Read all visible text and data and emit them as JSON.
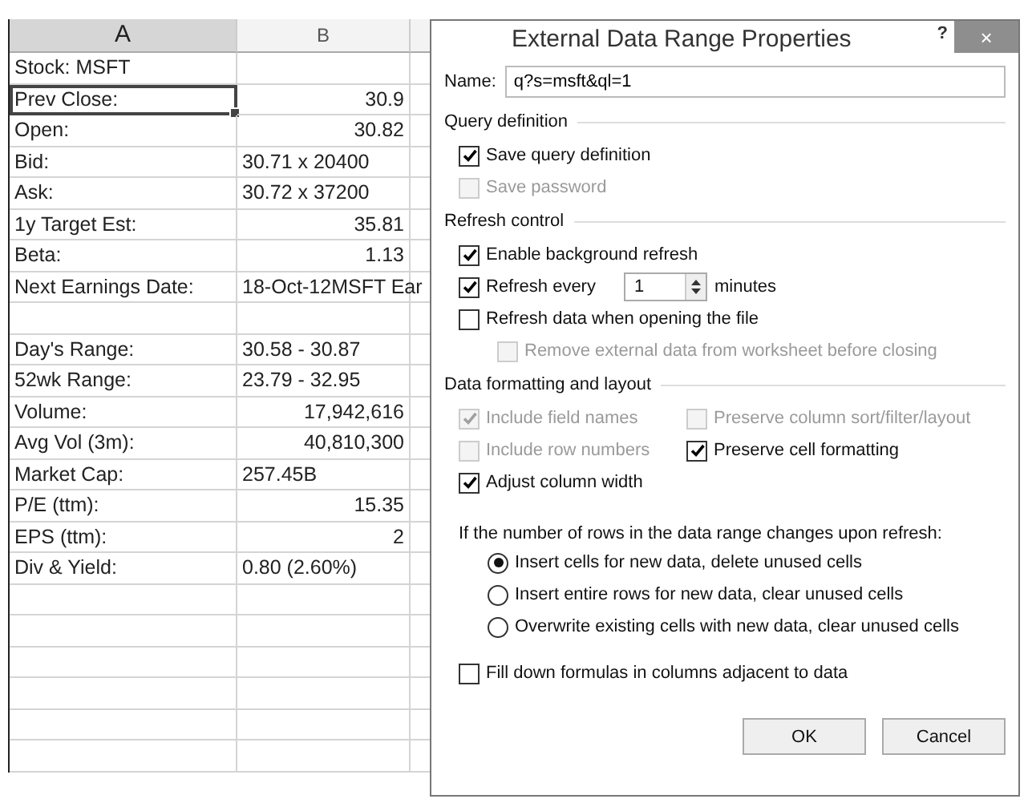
{
  "sheet": {
    "columns": [
      {
        "label": "A",
        "selected": true
      },
      {
        "label": "B",
        "selected": false
      }
    ],
    "rows": [
      {
        "a": "Stock: MSFT",
        "selected": false
      },
      {
        "a": "Prev Close:",
        "b": "30.9",
        "kind": "number",
        "selected": true
      },
      {
        "a": "Open:",
        "b": "30.82",
        "kind": "number",
        "selected": false
      },
      {
        "a": "Bid:",
        "b": "30.71 x 20400",
        "kind": "text",
        "selected": false
      },
      {
        "a": "Ask:",
        "b": "30.72 x 37200",
        "kind": "text",
        "selected": false
      },
      {
        "a": "1y Target Est:",
        "b": "35.81",
        "kind": "number",
        "selected": false
      },
      {
        "a": "Beta:",
        "b": "1.13",
        "kind": "number",
        "selected": false
      },
      {
        "a": "Next Earnings Date:",
        "b": "18-Oct-12MSFT Ear",
        "kind": "text",
        "selected": false
      },
      {
        "selected": false
      },
      {
        "a": "Day's Range:",
        "b": "30.58 - 30.87",
        "kind": "text",
        "selected": false
      },
      {
        "a": "52wk Range:",
        "b": "23.79 - 32.95",
        "kind": "text",
        "selected": false
      },
      {
        "a": "Volume:",
        "b": "17,942,616",
        "kind": "number",
        "selected": false
      },
      {
        "a": "Avg Vol (3m):",
        "b": "40,810,300",
        "kind": "number",
        "selected": false
      },
      {
        "a": "Market Cap:",
        "b": "257.45B",
        "kind": "text",
        "selected": false
      },
      {
        "a": "P/E (ttm):",
        "b": "15.35",
        "kind": "number",
        "selected": false
      },
      {
        "a": "EPS (ttm):",
        "b": "2",
        "kind": "number",
        "selected": false
      },
      {
        "a": "Div & Yield:",
        "b": "0.80 (2.60%)",
        "kind": "text",
        "selected": false
      },
      {
        "selected": false
      },
      {
        "selected": false
      },
      {
        "selected": false
      },
      {
        "selected": false
      },
      {
        "selected": false
      },
      {
        "selected": false
      }
    ]
  },
  "dialog": {
    "title": "External Data Range Properties",
    "help": "?",
    "close": "×",
    "name_field": {
      "label": "Name:",
      "value": "q?s=msft&ql=1"
    },
    "sections": [
      {
        "title": "Query definition",
        "kind": "list",
        "items": [
          {
            "kind": "checkbox",
            "label": "Save query definition",
            "checked": true,
            "disabled": false
          },
          {
            "kind": "checkbox",
            "label": "Save password",
            "checked": false,
            "disabled": true
          }
        ]
      },
      {
        "title": "Refresh control",
        "kind": "list",
        "items": [
          {
            "kind": "checkbox",
            "label": "Enable background refresh",
            "checked": true,
            "disabled": false
          },
          {
            "kind": "spinner",
            "label": "Refresh every",
            "checked": true,
            "disabled": false,
            "value": "1",
            "suffix": "minutes"
          },
          {
            "kind": "checkbox",
            "label": "Refresh data when opening the file",
            "checked": false,
            "disabled": false,
            "children": [
              {
                "kind": "checkbox",
                "label": "Remove external data from worksheet before closing",
                "checked": false,
                "disabled": true
              }
            ]
          }
        ]
      },
      {
        "title": "Data formatting and layout",
        "kind": "grid",
        "items": [
          {
            "kind": "checkbox",
            "label": "Include field names",
            "checked": true,
            "disabled": true
          },
          {
            "kind": "checkbox",
            "label": "Preserve column sort/filter/layout",
            "checked": false,
            "disabled": true
          },
          {
            "kind": "checkbox",
            "label": "Include row numbers",
            "checked": false,
            "disabled": true
          },
          {
            "kind": "checkbox",
            "label": "Preserve cell formatting",
            "checked": true,
            "disabled": false
          },
          {
            "kind": "checkbox",
            "label": "Adjust column width",
            "checked": true,
            "disabled": false
          }
        ]
      }
    ],
    "rows_prompt": "If the number of rows in the data range changes upon refresh:",
    "radios": [
      {
        "label": "Insert cells for new data, delete unused cells",
        "selected": true
      },
      {
        "label": "Insert entire rows for new data, clear unused cells",
        "selected": false
      },
      {
        "label": "Overwrite existing cells with new data, clear unused cells",
        "selected": false
      }
    ],
    "fill_down": {
      "label": "Fill down formulas in columns adjacent to data",
      "checked": false
    },
    "buttons": [
      "OK",
      "Cancel"
    ]
  }
}
